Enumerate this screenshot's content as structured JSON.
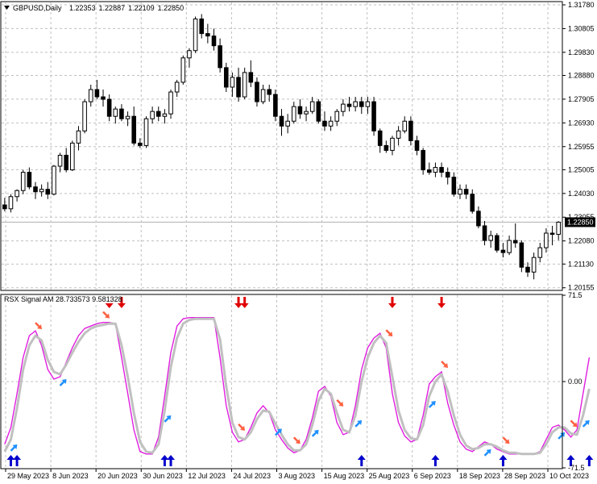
{
  "main_panel": {
    "title": "GBPUSD,Daily",
    "ohlc": [
      "1.22353",
      "1.22887",
      "1.22109",
      "1.22850"
    ],
    "price_labels": [
      "1.31780",
      "1.30805",
      "1.29830",
      "1.28880",
      "1.27905",
      "1.26930",
      "1.25955",
      "1.25005",
      "1.24030",
      "1.23055",
      "1.22080",
      "1.21130",
      "1.20155"
    ],
    "current_price": "1.22850",
    "price_range": [
      1.2008,
      1.3188
    ],
    "dropdown_icon": "triangle-down-icon"
  },
  "indicator_panel": {
    "title": "RSX Signal AM 28.733573 9.581328",
    "scale_labels": [
      "71.5",
      "0.00",
      "-71.5"
    ],
    "range": [
      -71.5,
      71.5
    ],
    "colors": {
      "fast": "#e01ee0",
      "slow": "#c0c0c0",
      "buy_big": "#0000cc",
      "sell_big": "#e00000",
      "buy_small": "#2090ff",
      "sell_small": "#ff6040"
    }
  },
  "x_labels": [
    "29 May 2023",
    "8 Jun 2023",
    "20 Jun 2023",
    "30 Jun 2023",
    "12 Jul 2023",
    "24 Jul 2023",
    "3 Aug 2023",
    "15 Aug 2023",
    "25 Aug 2023",
    "6 Sep 2023",
    "18 Sep 2023",
    "28 Sep 2023",
    "10 Oct 2023"
  ],
  "chart_data": {
    "type": "candlestick",
    "candles": [
      [
        1.2356,
        1.2385,
        1.233,
        1.234
      ],
      [
        1.234,
        1.24,
        1.2325,
        1.239
      ],
      [
        1.239,
        1.242,
        1.237,
        1.2415
      ],
      [
        1.2415,
        1.25,
        1.24,
        1.249
      ],
      [
        1.249,
        1.251,
        1.242,
        1.243
      ],
      [
        1.243,
        1.245,
        1.238,
        1.241
      ],
      [
        1.241,
        1.244,
        1.239,
        1.242
      ],
      [
        1.242,
        1.245,
        1.238,
        1.24
      ],
      [
        1.24,
        1.252,
        1.2395,
        1.2515
      ],
      [
        1.2515,
        1.257,
        1.249,
        1.256
      ],
      [
        1.256,
        1.259,
        1.249,
        1.25
      ],
      [
        1.25,
        1.262,
        1.2495,
        1.261
      ],
      [
        1.261,
        1.268,
        1.258,
        1.266
      ],
      [
        1.266,
        1.279,
        1.265,
        1.278
      ],
      [
        1.278,
        1.285,
        1.276,
        1.283
      ],
      [
        1.283,
        1.287,
        1.279,
        1.28
      ],
      [
        1.28,
        1.283,
        1.276,
        1.279
      ],
      [
        1.279,
        1.281,
        1.27,
        1.272
      ],
      [
        1.272,
        1.276,
        1.269,
        1.275
      ],
      [
        1.275,
        1.277,
        1.27,
        1.271
      ],
      [
        1.271,
        1.274,
        1.268,
        1.272
      ],
      [
        1.272,
        1.276,
        1.26,
        1.261
      ],
      [
        1.261,
        1.263,
        1.259,
        1.26
      ],
      [
        1.26,
        1.272,
        1.259,
        1.271
      ],
      [
        1.271,
        1.276,
        1.269,
        1.274
      ],
      [
        1.274,
        1.276,
        1.27,
        1.272
      ],
      [
        1.272,
        1.275,
        1.269,
        1.273
      ],
      [
        1.273,
        1.283,
        1.271,
        1.282
      ],
      [
        1.282,
        1.287,
        1.28,
        1.286
      ],
      [
        1.286,
        1.297,
        1.285,
        1.296
      ],
      [
        1.296,
        1.3,
        1.292,
        1.299
      ],
      [
        1.299,
        1.313,
        1.298,
        1.312
      ],
      [
        1.312,
        1.314,
        1.304,
        1.306
      ],
      [
        1.306,
        1.31,
        1.302,
        1.305
      ],
      [
        1.305,
        1.308,
        1.299,
        1.301
      ],
      [
        1.301,
        1.304,
        1.29,
        1.292
      ],
      [
        1.292,
        1.294,
        1.282,
        1.284
      ],
      [
        1.284,
        1.29,
        1.28,
        1.288
      ],
      [
        1.288,
        1.292,
        1.278,
        1.28
      ],
      [
        1.28,
        1.292,
        1.279,
        1.29
      ],
      [
        1.29,
        1.295,
        1.284,
        1.286
      ],
      [
        1.286,
        1.288,
        1.276,
        1.278
      ],
      [
        1.278,
        1.285,
        1.277,
        1.283
      ],
      [
        1.283,
        1.285,
        1.278,
        1.281
      ],
      [
        1.281,
        1.283,
        1.27,
        1.272
      ],
      [
        1.272,
        1.275,
        1.264,
        1.268
      ],
      [
        1.268,
        1.273,
        1.265,
        1.27
      ],
      [
        1.27,
        1.278,
        1.269,
        1.276
      ],
      [
        1.276,
        1.279,
        1.271,
        1.273
      ],
      [
        1.273,
        1.276,
        1.27,
        1.274
      ],
      [
        1.274,
        1.28,
        1.273,
        1.278
      ],
      [
        1.278,
        1.279,
        1.269,
        1.27
      ],
      [
        1.27,
        1.274,
        1.266,
        1.268
      ],
      [
        1.268,
        1.272,
        1.266,
        1.27
      ],
      [
        1.27,
        1.275,
        1.268,
        1.274
      ],
      [
        1.274,
        1.279,
        1.272,
        1.277
      ],
      [
        1.277,
        1.28,
        1.274,
        1.276
      ],
      [
        1.276,
        1.28,
        1.274,
        1.278
      ],
      [
        1.278,
        1.28,
        1.273,
        1.276
      ],
      [
        1.276,
        1.28,
        1.273,
        1.278
      ],
      [
        1.278,
        1.28,
        1.264,
        1.266
      ],
      [
        1.266,
        1.267,
        1.257,
        1.26
      ],
      [
        1.26,
        1.262,
        1.257,
        1.258
      ],
      [
        1.258,
        1.264,
        1.256,
        1.263
      ],
      [
        1.263,
        1.268,
        1.26,
        1.266
      ],
      [
        1.266,
        1.272,
        1.265,
        1.27
      ],
      [
        1.27,
        1.272,
        1.26,
        1.262
      ],
      [
        1.262,
        1.264,
        1.256,
        1.258
      ],
      [
        1.258,
        1.259,
        1.248,
        1.25
      ],
      [
        1.25,
        1.253,
        1.248,
        1.249
      ],
      [
        1.249,
        1.253,
        1.247,
        1.251
      ],
      [
        1.251,
        1.253,
        1.247,
        1.249
      ],
      [
        1.249,
        1.251,
        1.244,
        1.247
      ],
      [
        1.247,
        1.249,
        1.239,
        1.24
      ],
      [
        1.24,
        1.244,
        1.238,
        1.242
      ],
      [
        1.242,
        1.244,
        1.238,
        1.24
      ],
      [
        1.24,
        1.242,
        1.232,
        1.233
      ],
      [
        1.233,
        1.235,
        1.226,
        1.227
      ],
      [
        1.227,
        1.229,
        1.219,
        1.221
      ],
      [
        1.221,
        1.225,
        1.218,
        1.223
      ],
      [
        1.223,
        1.224,
        1.216,
        1.217
      ],
      [
        1.217,
        1.22,
        1.214,
        1.216
      ],
      [
        1.216,
        1.223,
        1.215,
        1.221
      ],
      [
        1.221,
        1.228,
        1.218,
        1.22
      ],
      [
        1.22,
        1.221,
        1.208,
        1.21
      ],
      [
        1.21,
        1.212,
        1.206,
        1.208
      ],
      [
        1.208,
        1.216,
        1.205,
        1.214
      ],
      [
        1.214,
        1.22,
        1.212,
        1.218
      ],
      [
        1.218,
        1.226,
        1.216,
        1.224
      ],
      [
        1.224,
        1.227,
        1.219,
        1.2235
      ],
      [
        1.2235,
        1.2289,
        1.2211,
        1.2285
      ]
    ],
    "rsx_fast": [
      -52,
      -38,
      -10,
      20,
      38,
      42,
      30,
      10,
      2,
      4,
      16,
      28,
      38,
      44,
      46,
      48,
      49,
      49,
      48,
      20,
      -10,
      -40,
      -58,
      -60,
      -60,
      -46,
      -12,
      24,
      46,
      52,
      53,
      53,
      53,
      53,
      53,
      20,
      -20,
      -42,
      -50,
      -48,
      -38,
      -26,
      -20,
      -26,
      -40,
      -48,
      -55,
      -59,
      -57,
      -48,
      -30,
      -8,
      -4,
      -12,
      -34,
      -44,
      -42,
      -20,
      10,
      28,
      36,
      40,
      28,
      -10,
      -34,
      -45,
      -50,
      -48,
      -28,
      -2,
      4,
      8,
      -18,
      -36,
      -50,
      -56,
      -58,
      -54,
      -50,
      -52,
      -56,
      -58,
      -60,
      -60,
      -60,
      -60,
      -60,
      -58,
      -48,
      -38,
      -36,
      -40,
      -46,
      -40,
      -10,
      20
    ],
    "rsx_slow": [
      -58,
      -48,
      -22,
      10,
      30,
      38,
      34,
      18,
      8,
      6,
      14,
      24,
      33,
      40,
      44,
      46,
      47,
      48,
      48,
      30,
      4,
      -26,
      -50,
      -58,
      -59,
      -52,
      -24,
      12,
      36,
      48,
      51,
      52,
      52,
      52,
      52,
      35,
      -4,
      -34,
      -46,
      -48,
      -42,
      -31,
      -24,
      -25,
      -35,
      -44,
      -52,
      -57,
      -57,
      -52,
      -36,
      -16,
      -6,
      -10,
      -26,
      -40,
      -42,
      -28,
      0,
      20,
      32,
      38,
      32,
      4,
      -24,
      -40,
      -47,
      -48,
      -36,
      -12,
      0,
      6,
      -8,
      -28,
      -44,
      -53,
      -56,
      -55,
      -52,
      -52,
      -54,
      -57,
      -59,
      -59,
      -60,
      -60,
      -60,
      -59,
      -52,
      -42,
      -38,
      -38,
      -43,
      -44,
      -28,
      -6
    ],
    "buy_big": [
      1,
      2,
      26,
      27,
      58,
      70,
      81,
      92,
      95
    ],
    "sell_big": [
      17,
      19,
      38,
      39,
      63,
      71
    ],
    "buy_small": [
      1,
      9,
      26,
      44,
      50,
      57,
      69,
      78,
      90,
      94
    ],
    "sell_small": [
      5,
      16,
      38,
      47,
      54,
      62,
      71,
      81,
      92
    ]
  }
}
